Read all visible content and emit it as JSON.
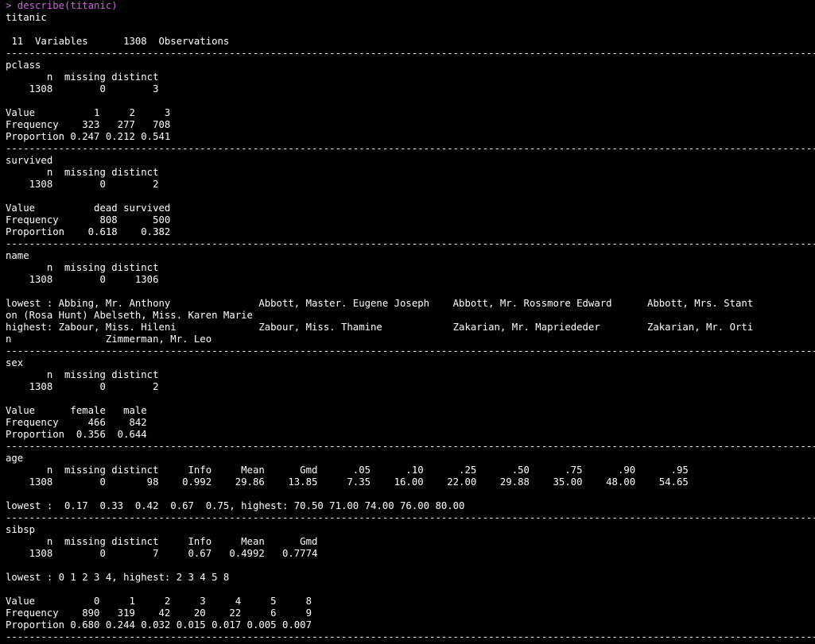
{
  "console": {
    "lines": [
      "> describe(titanic)",
      "titanic",
      "",
      " 11  Variables      1308  Observations",
      "-----------------------------------------------------------------------------------------------------------------------------------------------",
      "pclass",
      "       n  missing distinct",
      "    1308        0        3",
      "",
      "Value          1     2     3",
      "Frequency    323   277   708",
      "Proportion 0.247 0.212 0.541",
      "-----------------------------------------------------------------------------------------------------------------------------------------------",
      "survived",
      "       n  missing distinct",
      "    1308        0        2",
      "",
      "Value          dead survived",
      "Frequency       808      500",
      "Proportion    0.618    0.382",
      "-----------------------------------------------------------------------------------------------------------------------------------------------",
      "name",
      "       n  missing distinct",
      "    1308        0     1306",
      "",
      "lowest : Abbing, Mr. Anthony               Abbott, Master. Eugene Joseph    Abbott, Mr. Rossmore Edward      Abbott, Mrs. Stant",
      "on (Rosa Hunt) Abelseth, Miss. Karen Marie",
      "highest: Zabour, Miss. Hileni              Zabour, Miss. Thamine            Zakarian, Mr. Mapriededer        Zakarian, Mr. Orti",
      "n                Zimmerman, Mr. Leo",
      "-----------------------------------------------------------------------------------------------------------------------------------------------",
      "sex",
      "       n  missing distinct",
      "    1308        0        2",
      "",
      "Value      female   male",
      "Frequency     466    842",
      "Proportion  0.356  0.644",
      "-----------------------------------------------------------------------------------------------------------------------------------------------",
      "age",
      "       n  missing distinct     Info     Mean      Gmd      .05      .10      .25      .50      .75      .90      .95",
      "    1308        0       98    0.992    29.86    13.85     7.35    16.00    22.00    29.88    35.00    48.00    54.65",
      "",
      "lowest :  0.17  0.33  0.42  0.67  0.75, highest: 70.50 71.00 74.00 76.00 80.00",
      "-----------------------------------------------------------------------------------------------------------------------------------------------",
      "sibsp",
      "       n  missing distinct     Info     Mean      Gmd",
      "    1308        0        7     0.67   0.4992   0.7774",
      "",
      "lowest : 0 1 2 3 4, highest: 2 3 4 5 8",
      "",
      "Value          0     1     2     3     4     5     8",
      "Frequency    890   319    42    20    22     6     9",
      "Proportion 0.680 0.244 0.032 0.015 0.017 0.005 0.007",
      "-----------------------------------------------------------------------------------------------------------------------------------------------"
    ]
  },
  "colors": {
    "background": "#000000",
    "text": "#ffffff",
    "command": "#c46bd1"
  }
}
